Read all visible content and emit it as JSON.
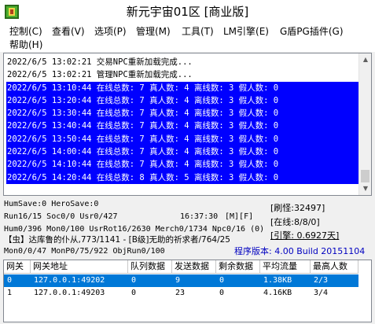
{
  "window": {
    "title": "新元宇宙01区 [商业版]"
  },
  "menu": [
    "控制(C)",
    "查看(V)",
    "选项(P)",
    "管理(M)",
    "工具(T)",
    "LM引擎(E)",
    "G盾PG插件(G)",
    "帮助(H)"
  ],
  "log": {
    "lines": [
      {
        "text": "2022/6/5 13:02:21 交易NPC重新加载完成...",
        "selected": false
      },
      {
        "text": "2022/6/5 13:02:21 管理NPC重新加载完成...",
        "selected": false
      },
      {
        "text": "2022/6/5 13:10:44 在线总数: 7 真人数: 4 离线数: 3 假人数: 0",
        "selected": true
      },
      {
        "text": "2022/6/5 13:20:44 在线总数: 7 真人数: 4 离线数: 3 假人数: 0",
        "selected": true
      },
      {
        "text": "2022/6/5 13:30:44 在线总数: 7 真人数: 4 离线数: 3 假人数: 0",
        "selected": true
      },
      {
        "text": "2022/6/5 13:40:44 在线总数: 7 真人数: 4 离线数: 3 假人数: 0",
        "selected": true
      },
      {
        "text": "2022/6/5 13:50:44 在线总数: 7 真人数: 4 离线数: 3 假人数: 0",
        "selected": true
      },
      {
        "text": "2022/6/5 14:00:44 在线总数: 7 真人数: 4 离线数: 3 假人数: 0",
        "selected": true
      },
      {
        "text": "2022/6/5 14:10:44 在线总数: 7 真人数: 4 离线数: 3 假人数: 0",
        "selected": true
      },
      {
        "text": "2022/6/5 14:20:44 在线总数: 8 真人数: 5 离线数: 3 假人数: 0",
        "selected": true
      }
    ]
  },
  "status": {
    "line1": "HumSave:0 HeroSave:0",
    "line2": "Run16/15 Soc0/0 Usr0/427",
    "time": "16:37:30",
    "flags": "[M][F]",
    "line3": "Hum0/396 Mon0/100 UsrRot16/2630 Merch0/1734 Npc0/16 (0)",
    "line4": "【虫】达库鲁的仆从,773/1141 - [B级]无助的祈求者/764/25",
    "line5": "Mon0/0/47 MonP0/75/922 ObjRun0/100",
    "refresh": "[刷怪:32497]",
    "online": "[在线:8/8/0]",
    "engine": "[引擎: 0.6927天]",
    "version": "程序版本: 4.00 Build 20151104"
  },
  "grid": {
    "columns": [
      "网关",
      "网关地址",
      "队列数据",
      "发送数据",
      "剩余数据",
      "平均流量",
      "最高人数"
    ],
    "rows": [
      {
        "selected": true,
        "cells": [
          "0",
          "127.0.0.1:49202",
          "0",
          "9",
          "0",
          "1.38KB",
          "2/3"
        ]
      },
      {
        "selected": false,
        "cells": [
          "1",
          "127.0.0.1:49203",
          "0",
          "23",
          "0",
          "4.16KB",
          "3/4"
        ]
      }
    ]
  },
  "icons": {
    "app": "game-app-icon",
    "scroll_up": "scroll-up-arrow-icon",
    "scroll_down": "scroll-down-arrow-icon"
  },
  "colors": {
    "selection": "#0000ff",
    "grid_selection": "#0078d7",
    "version": "#0000c0"
  }
}
